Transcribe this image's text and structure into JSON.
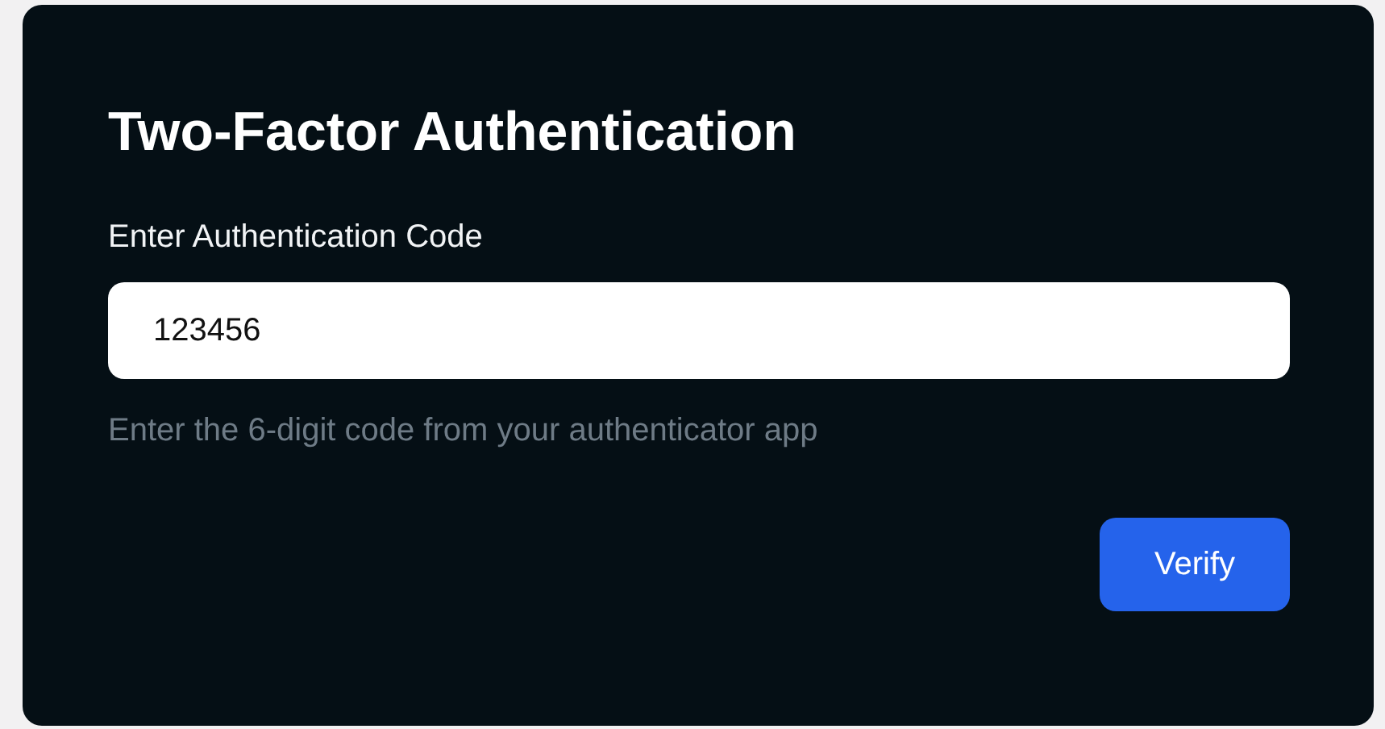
{
  "dialog": {
    "title": "Two-Factor Authentication",
    "field": {
      "label": "Enter Authentication Code",
      "value": "123456"
    },
    "hint": "Enter the 6-digit code from your authenticator app",
    "buttons": [
      "Verify"
    ]
  }
}
